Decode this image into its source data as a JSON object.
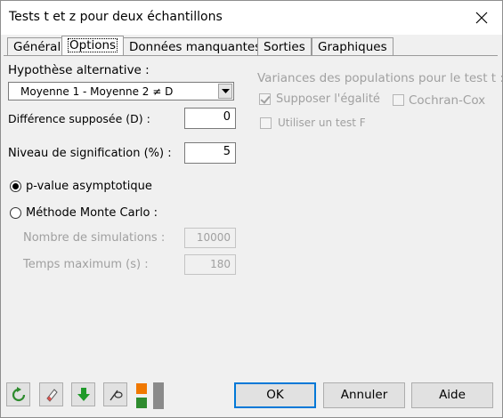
{
  "window": {
    "title": "Tests t et z pour deux échantillons"
  },
  "tabs": [
    {
      "label": "Général",
      "active": false
    },
    {
      "label": "Options",
      "active": true
    },
    {
      "label": "Données manquantes",
      "active": false
    },
    {
      "label": "Sorties",
      "active": false
    },
    {
      "label": "Graphiques",
      "active": false
    }
  ],
  "options": {
    "alt_hypothesis_label": "Hypothèse alternative :",
    "alt_hypothesis_value": "Moyenne 1 - Moyenne 2 ≠ D",
    "diff_label": "Différence supposée (D) :",
    "diff_value": "0",
    "signif_label": "Niveau de signification (%) :",
    "signif_value": "5",
    "pvalue_asymptotic_label": "p-value asymptotique",
    "pvalue_asymptotic_selected": true,
    "monte_carlo_label": "Méthode Monte Carlo :",
    "monte_carlo_selected": false,
    "simulations_label": "Nombre de simulations :",
    "simulations_value": "10000",
    "max_time_label": "Temps maximum (s) :",
    "max_time_value": "180",
    "variances_label": "Variances des populations pour le test t :",
    "equal_var_label": "Supposer l'égalité",
    "equal_var_checked": true,
    "cochran_label": "Cochran-Cox",
    "cochran_checked": false,
    "f_test_label": "Utiliser un test F",
    "f_test_checked": false
  },
  "footer": {
    "icons": [
      "reset-icon",
      "eraser-icon",
      "down-arrow-icon",
      "pointer-icon",
      "layout-toggle-icon"
    ],
    "ok_label": "OK",
    "cancel_label": "Annuler",
    "help_label": "Aide"
  },
  "colors": {
    "accent": "#0078d7",
    "green_icon": "#2e8b2e",
    "orange_icon": "#f07800",
    "disabled_text": "#a0a0a0"
  }
}
